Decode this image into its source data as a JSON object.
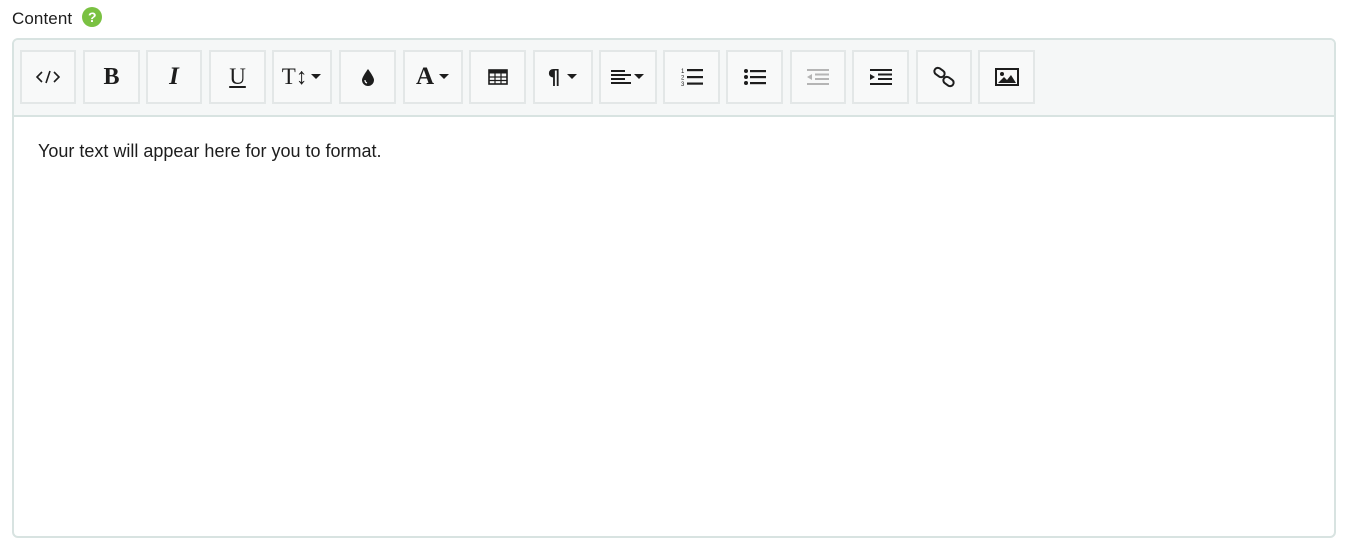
{
  "field": {
    "label": "Content",
    "help_icon_glyph": "?",
    "help_color": "#7ac142"
  },
  "toolbar": {
    "buttons": [
      {
        "name": "code-view-button",
        "icon": "code-icon"
      },
      {
        "name": "bold-button",
        "icon": "bold-icon",
        "glyph": "B"
      },
      {
        "name": "italic-button",
        "icon": "italic-icon",
        "glyph": "I"
      },
      {
        "name": "underline-button",
        "icon": "underline-icon",
        "glyph": "U"
      },
      {
        "name": "font-size-dropdown",
        "icon": "font-size-icon",
        "glyph": "T↕"
      },
      {
        "name": "text-color-button",
        "icon": "droplet-icon"
      },
      {
        "name": "font-family-dropdown",
        "icon": "font-icon",
        "glyph": "A"
      },
      {
        "name": "table-button",
        "icon": "table-icon"
      },
      {
        "name": "paragraph-format-dropdown",
        "icon": "paragraph-icon",
        "glyph": "¶"
      },
      {
        "name": "align-dropdown",
        "icon": "align-left-icon"
      },
      {
        "name": "ordered-list-button",
        "icon": "ordered-list-icon"
      },
      {
        "name": "unordered-list-button",
        "icon": "unordered-list-icon"
      },
      {
        "name": "outdent-button",
        "icon": "outdent-icon",
        "disabled": true
      },
      {
        "name": "indent-button",
        "icon": "indent-icon"
      },
      {
        "name": "link-button",
        "icon": "link-icon"
      },
      {
        "name": "image-button",
        "icon": "image-icon"
      }
    ]
  },
  "editor": {
    "text": "Your text will appear here for you to format."
  },
  "colors": {
    "border": "#d8e3e1",
    "toolbar_bg": "#f5f7f7",
    "icon": "#1d1d1d",
    "icon_disabled": "#b5b5b5"
  }
}
